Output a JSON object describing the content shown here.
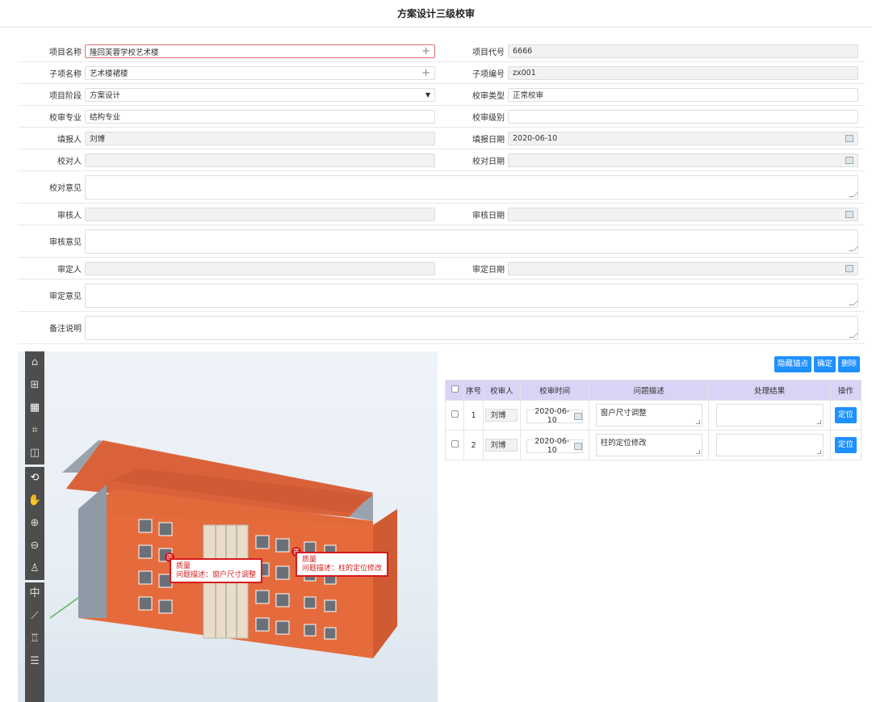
{
  "page": {
    "title": "方案设计三级校审"
  },
  "form": {
    "project_name_label": "项目名称",
    "project_name": "隆回芙蓉学校艺术楼",
    "project_code_label": "项目代号",
    "project_code": "6666",
    "sub_name_label": "子项名称",
    "sub_name": "艺术楼裙楼",
    "sub_code_label": "子项编号",
    "sub_code": "zx001",
    "stage_label": "项目阶段",
    "stage": "方案设计",
    "review_type_label": "校审类型",
    "review_type": "正常校审",
    "major_label": "校审专业",
    "major": "结构专业",
    "level_label": "校审级别",
    "level": "",
    "reporter_label": "填报人",
    "reporter": "刘博",
    "report_date_label": "填报日期",
    "report_date": "2020-06-10",
    "checker_label": "校对人",
    "check_date_label": "校对日期",
    "check_opinion_label": "校对意见",
    "auditor_label": "审核人",
    "audit_date_label": "审核日期",
    "audit_opinion_label": "审核意见",
    "approver_label": "审定人",
    "approve_date_label": "审定日期",
    "approve_opinion_label": "审定意见",
    "remark_label": "备注说明"
  },
  "panel": {
    "buttons": {
      "hide_anchors": "隐藏锚点",
      "confirm": "确定",
      "delete": "删除"
    },
    "columns": [
      "序号",
      "校审人",
      "校审时间",
      "问题描述",
      "处理结果",
      "操作"
    ],
    "rows": [
      {
        "no": "1",
        "reviewer": "刘博",
        "date": "2020-06-10",
        "issue": "窗户尺寸调整",
        "result": "",
        "action": "定位"
      },
      {
        "no": "2",
        "reviewer": "刘博",
        "date": "2020-06-10",
        "issue": "柱的定位修改",
        "result": "",
        "action": "定位"
      }
    ]
  },
  "viewer": {
    "markers": [
      {
        "pin": "质",
        "category": "质量",
        "text": "问题描述：窗户尺寸调整"
      },
      {
        "pin": "质",
        "category": "质量",
        "text": "问题描述：柱的定位修改"
      }
    ],
    "tools": [
      "home-icon",
      "perspective-icon",
      "grid-view-icon",
      "fit-icon",
      "section-box-icon",
      "orbit-icon",
      "pan-hand-icon",
      "zoom-in-icon",
      "zoom-out-icon",
      "walk-person-icon",
      "center-icon",
      "measure-ruler-icon",
      "structure-tree-icon",
      "properties-list-icon"
    ],
    "center_label": "中"
  }
}
